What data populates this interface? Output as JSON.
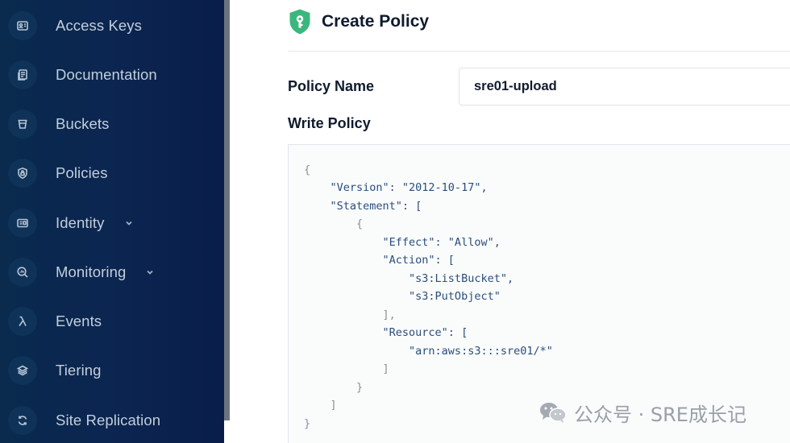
{
  "sidebar": {
    "items": [
      {
        "label": "Access Keys",
        "icon": "id-card-icon",
        "has_chevron": false
      },
      {
        "label": "Documentation",
        "icon": "document-icon",
        "has_chevron": false
      },
      {
        "label": "Buckets",
        "icon": "bucket-icon",
        "has_chevron": false
      },
      {
        "label": "Policies",
        "icon": "shield-lock-icon",
        "has_chevron": false
      },
      {
        "label": "Identity",
        "icon": "identity-card-icon",
        "has_chevron": true
      },
      {
        "label": "Monitoring",
        "icon": "magnifier-chart-icon",
        "has_chevron": true
      },
      {
        "label": "Events",
        "icon": "lambda-icon",
        "has_chevron": false
      },
      {
        "label": "Tiering",
        "icon": "layers-icon",
        "has_chevron": false
      },
      {
        "label": "Site Replication",
        "icon": "sync-icon",
        "has_chevron": false
      }
    ]
  },
  "page": {
    "title": "Create Policy",
    "icon": "shield-key-icon"
  },
  "form": {
    "policy_name_label": "Policy Name",
    "policy_name_value": "sre01-upload",
    "write_policy_label": "Write Policy"
  },
  "policy_code": {
    "lines": [
      "{",
      "    \"Version\": \"2012-10-17\",",
      "    \"Statement\": [",
      "        {",
      "            \"Effect\": \"Allow\",",
      "            \"Action\": [",
      "                \"s3:ListBucket\",",
      "                \"s3:PutObject\"",
      "            ],",
      "            \"Resource\": [",
      "                \"arn:aws:s3:::sre01/*\"",
      "            ]",
      "        }",
      "    ]",
      "}"
    ]
  },
  "watermark": {
    "text": "公众号 · SRE成长记",
    "icon": "wechat-icon"
  },
  "colors": {
    "sidebar_bg": "#0b2550",
    "accent_green": "#3bb77e",
    "title_text": "#0f1b2d",
    "code_text": "#2a4e7d"
  }
}
